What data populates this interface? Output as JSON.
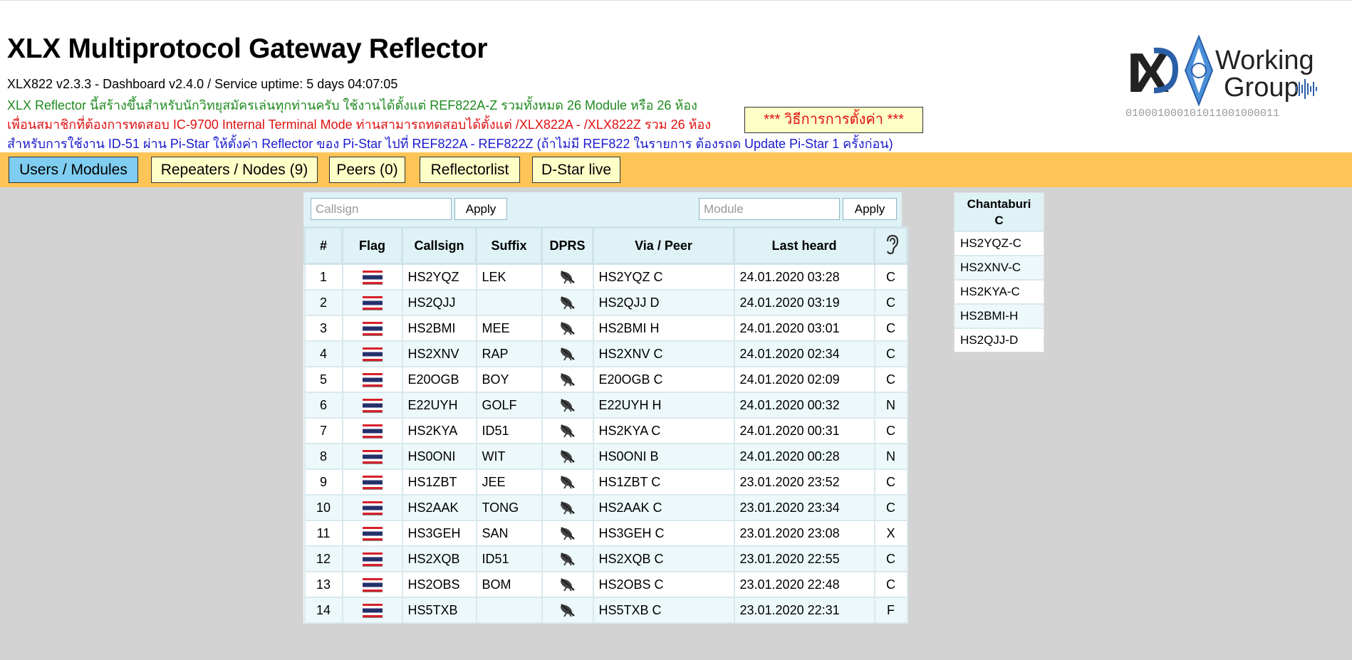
{
  "header": {
    "title": "XLX Multiprotocol Gateway Reflector",
    "version_line": "XLX822 v2.3.3 - Dashboard v2.4.0   /  Service uptime: 5 days 04:07:05",
    "info_green": "XLX Reflector นี้สร้างขึ้นสำหรับนักวิทยุสมัครเล่นทุกท่านครับ ใช้งานได้ตั้งแต่ REF822A-Z รวมทั้งหมด 26 Module หรือ 26 ห้อง",
    "info_red": "เพื่อนสมาชิกที่ต้องการทดสอบ IC-9700 Internal Terminal Mode ท่านสามารถทดสอบได้ตั้งแต่ /XLX822A - /XLX822Z รวม 26 ห้อง",
    "info_blue": "สำหรับการใช้งาน ID-51 ผ่าน Pi-Star ให้ตั้งค่า Reflector ของ Pi-Star ไปที่ REF822A - REF822Z (ถ้าไม่มี REF822 ในรายการ ต้องรถด Update Pi-Star 1 ครั้งก่อน)",
    "howto_label": "*** วิธีการการตั้งค่า ***",
    "logo": {
      "line1": "Working",
      "line2": "Group",
      "binary": "010001000101011001000011"
    }
  },
  "nav": {
    "tabs": [
      {
        "label": "Users / Modules",
        "active": true
      },
      {
        "label": "Repeaters / Nodes (9)",
        "active": false
      },
      {
        "label": "Peers (0)",
        "active": false
      },
      {
        "label": "Reflectorlist",
        "active": false
      },
      {
        "label": "D-Star live",
        "active": false
      }
    ]
  },
  "filters": {
    "callsign_placeholder": "Callsign",
    "module_placeholder": "Module",
    "apply_label": "Apply"
  },
  "table": {
    "columns": [
      "#",
      "Flag",
      "Callsign",
      "Suffix",
      "DPRS",
      "Via / Peer",
      "Last heard",
      "ear-icon"
    ],
    "rows": [
      {
        "n": "1",
        "callsign": "HS2YQZ",
        "suffix": "LEK",
        "via": "HS2YQZ C",
        "last": "24.01.2020 03:28",
        "module": "C"
      },
      {
        "n": "2",
        "callsign": "HS2QJJ",
        "suffix": "",
        "via": "HS2QJJ D",
        "last": "24.01.2020 03:19",
        "module": "C"
      },
      {
        "n": "3",
        "callsign": "HS2BMI",
        "suffix": "MEE",
        "via": "HS2BMI H",
        "last": "24.01.2020 03:01",
        "module": "C"
      },
      {
        "n": "4",
        "callsign": "HS2XNV",
        "suffix": "RAP",
        "via": "HS2XNV C",
        "last": "24.01.2020 02:34",
        "module": "C"
      },
      {
        "n": "5",
        "callsign": "E20OGB",
        "suffix": "BOY",
        "via": "E20OGB C",
        "last": "24.01.2020 02:09",
        "module": "C"
      },
      {
        "n": "6",
        "callsign": "E22UYH",
        "suffix": "GOLF",
        "via": "E22UYH H",
        "last": "24.01.2020 00:32",
        "module": "N"
      },
      {
        "n": "7",
        "callsign": "HS2KYA",
        "suffix": "ID51",
        "via": "HS2KYA C",
        "last": "24.01.2020 00:31",
        "module": "C"
      },
      {
        "n": "8",
        "callsign": "HS0ONI",
        "suffix": "WIT",
        "via": "HS0ONI B",
        "last": "24.01.2020 00:28",
        "module": "N"
      },
      {
        "n": "9",
        "callsign": "HS1ZBT",
        "suffix": "JEE",
        "via": "HS1ZBT C",
        "last": "23.01.2020 23:52",
        "module": "C"
      },
      {
        "n": "10",
        "callsign": "HS2AAK",
        "suffix": "TONG",
        "via": "HS2AAK C",
        "last": "23.01.2020 23:34",
        "module": "C"
      },
      {
        "n": "11",
        "callsign": "HS3GEH",
        "suffix": "SAN",
        "via": "HS3GEH C",
        "last": "23.01.2020 23:08",
        "module": "X"
      },
      {
        "n": "12",
        "callsign": "HS2XQB",
        "suffix": "ID51",
        "via": "HS2XQB C",
        "last": "23.01.2020 22:55",
        "module": "C"
      },
      {
        "n": "13",
        "callsign": "HS2OBS",
        "suffix": "BOM",
        "via": "HS2OBS C",
        "last": "23.01.2020 22:48",
        "module": "C"
      },
      {
        "n": "14",
        "callsign": "HS5TXB",
        "suffix": "",
        "via": "HS5TXB C",
        "last": "23.01.2020 22:31",
        "module": "F"
      }
    ]
  },
  "module_panel": {
    "title_line1": "Chantaburi",
    "title_line2": "C",
    "items": [
      "HS2YQZ-C",
      "HS2XNV-C",
      "HS2KYA-C",
      "HS2BMI-H",
      "HS2QJJ-D"
    ]
  },
  "colors": {
    "navbar": "#fdc557",
    "tab_active": "#7fcdf0",
    "tab_inactive": "#ffffc8",
    "text_green": "#1f8a1f",
    "text_red": "#e01010",
    "text_blue": "#1a1ad0",
    "logo_blue": "#2a5fa8"
  }
}
